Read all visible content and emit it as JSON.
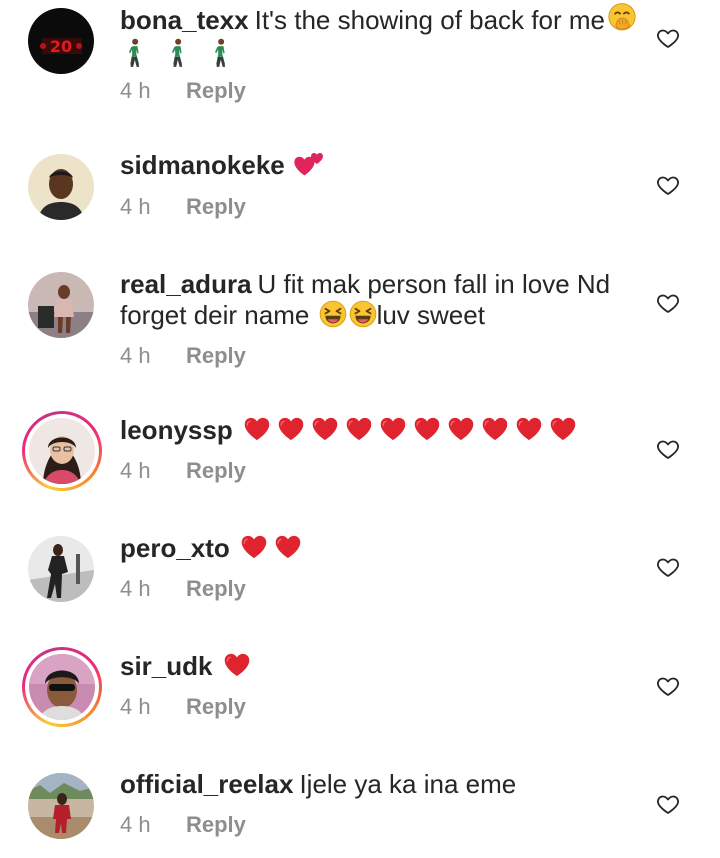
{
  "comments": [
    {
      "username": "bona_texx",
      "text": "It's the showing of back for me",
      "time": "4 h",
      "reply": "Reply"
    },
    {
      "username": "sidmanokeke",
      "text": "",
      "time": "4 h",
      "reply": "Reply"
    },
    {
      "username": "real_adura",
      "text": "U fit mak person fall in love Nd",
      "text2": "forget deir name",
      "text3": "luv sweet",
      "time": "4 h",
      "reply": "Reply"
    },
    {
      "username": "leonyssp",
      "text": "",
      "time": "4 h",
      "reply": "Reply"
    },
    {
      "username": "pero_xto",
      "text": "",
      "time": "4 h",
      "reply": "Reply"
    },
    {
      "username": "sir_udk",
      "text": "",
      "time": "4 h",
      "reply": "Reply"
    },
    {
      "username": "official_reelax",
      "text": "Ijele ya ka ina eme",
      "time": "4 h",
      "reply": "Reply"
    }
  ],
  "icons": {
    "like": "heart-outline-icon",
    "red_heart": "red-heart-emoji",
    "hand_over_mouth": "face-with-hand-over-mouth-emoji",
    "walking": "person-walking-emoji",
    "two_hearts": "two-hearts-emoji",
    "laughing": "grinning-squinting-face-emoji"
  },
  "colors": {
    "text": "#262626",
    "secondary": "#8e8e8e",
    "heart_red": "#e0242f"
  }
}
